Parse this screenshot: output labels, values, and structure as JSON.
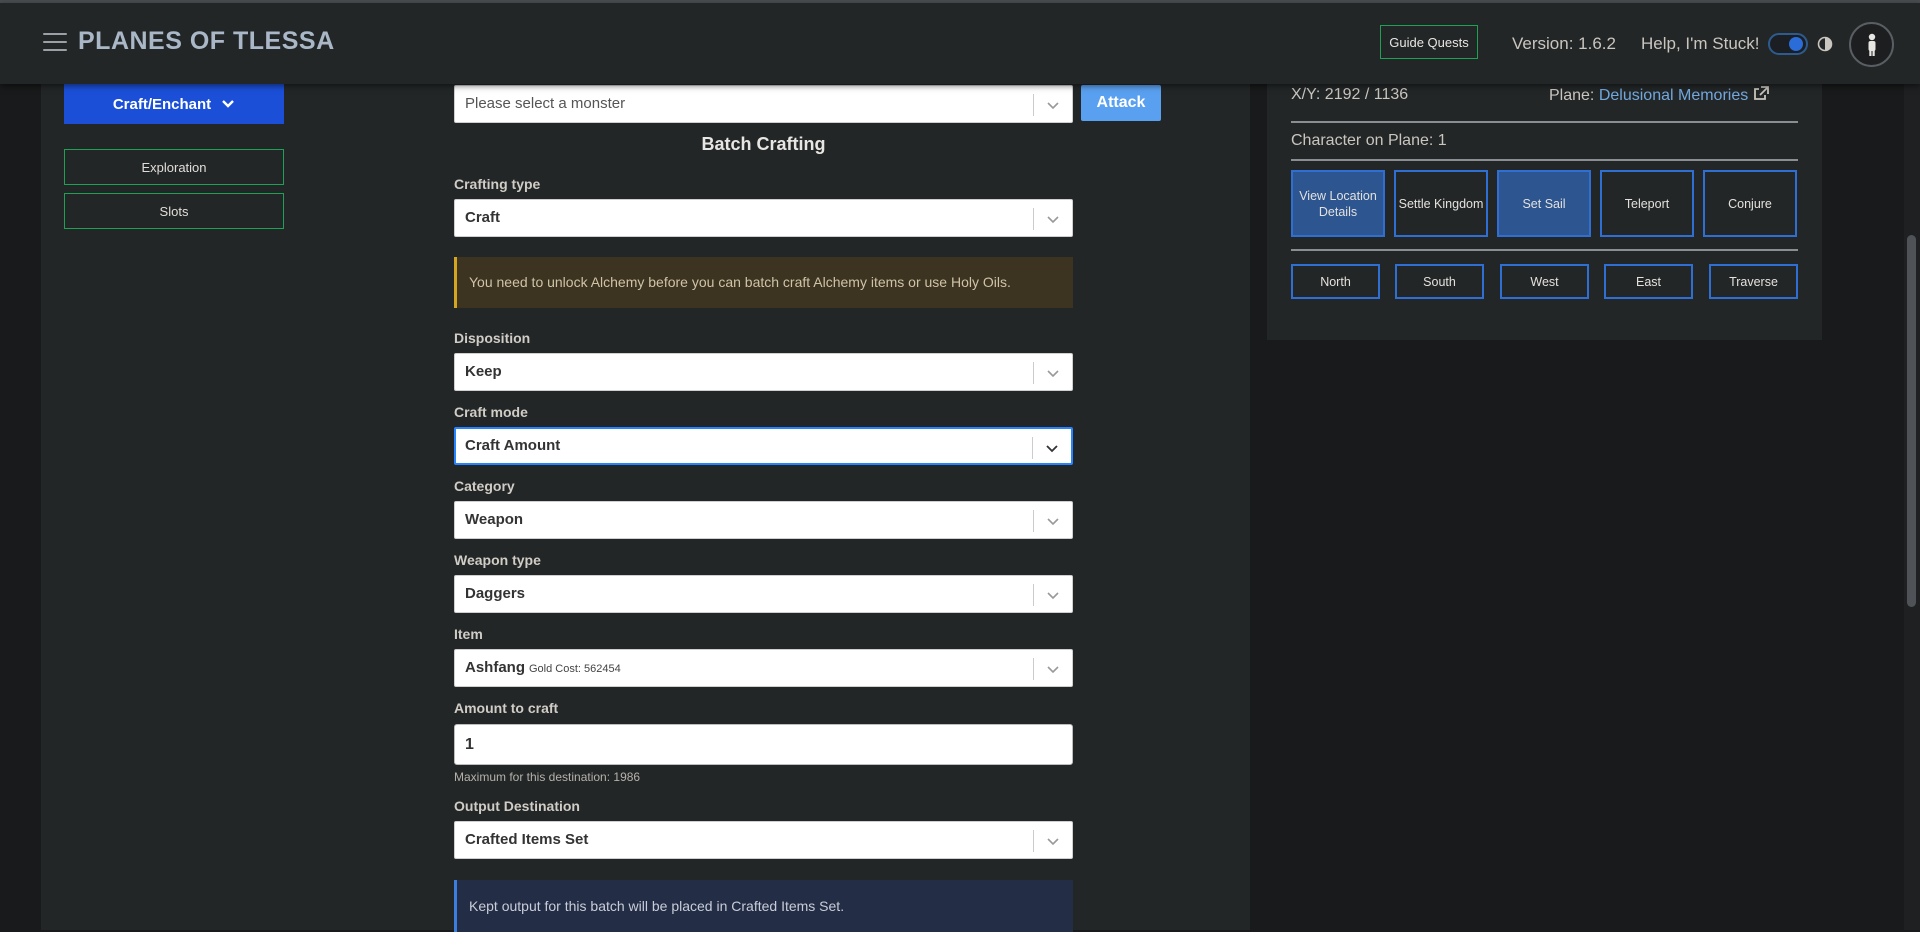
{
  "header": {
    "app_title": "PLANES OF TLESSA",
    "guide_quests_label": "Guide Quests",
    "version": "Version: 1.6.2",
    "help_label": "Help, I'm Stuck!",
    "dark_mode_enabled": true
  },
  "sidebar": {
    "craft_label": "Craft/Enchant",
    "exploration_label": "Exploration",
    "slots_label": "Slots"
  },
  "combat": {
    "monster_placeholder": "Please select a monster",
    "attack_label": "Attack"
  },
  "batch": {
    "title": "Batch Crafting",
    "crafting_type_label": "Crafting type",
    "crafting_type_value": "Craft",
    "alchemy_notice": "You need to unlock Alchemy before you can batch craft Alchemy items or use Holy Oils.",
    "disposition_label": "Disposition",
    "disposition_value": "Keep",
    "craft_mode_label": "Craft mode",
    "craft_mode_value": "Craft Amount",
    "category_label": "Category",
    "category_value": "Weapon",
    "weapon_type_label": "Weapon type",
    "weapon_type_value": "Daggers",
    "item_label": "Item",
    "item_name": "Ashfang",
    "item_gold_cost": "Gold Cost: 562454",
    "amount_label": "Amount to craft",
    "amount_value": "1",
    "amount_hint": "Maximum for this destination: 1986",
    "output_label": "Output Destination",
    "output_value": "Crafted Items Set",
    "output_notice": "Kept output for this batch will be placed in Crafted Items Set."
  },
  "map_panel": {
    "coordinates": "X/Y: 2192 / 1136",
    "plane_label": "Plane:",
    "plane_name": "Delusional Memories",
    "characters_on_plane": "Character on Plane: 1",
    "actions": [
      "View Location Details",
      "Settle Kingdom",
      "Set Sail",
      "Teleport",
      "Conjure"
    ],
    "directions": [
      "North",
      "South",
      "West",
      "East",
      "Traverse"
    ]
  },
  "colors": {
    "accent_blue": "#1b4fd8",
    "success_green": "#1fa055",
    "link_blue": "#72a8de",
    "warning_border": "#d3a520",
    "info_border": "#3c7de0"
  }
}
